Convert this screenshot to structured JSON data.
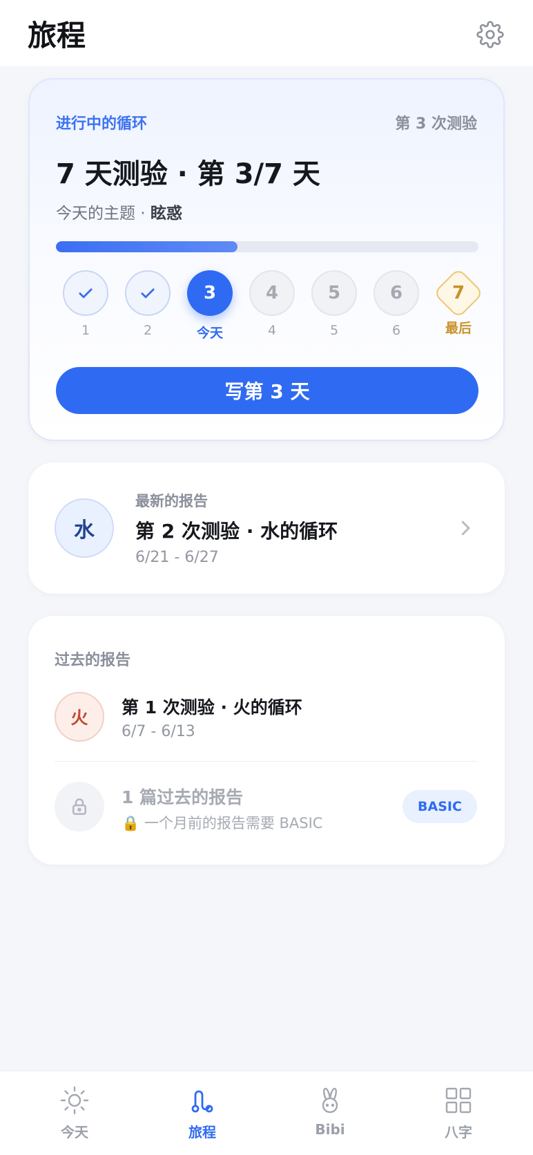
{
  "header": {
    "title": "旅程"
  },
  "cycle": {
    "tag": "进行中的循环",
    "test_count": "第 3 次测验",
    "title": "7 天测验 · 第 3/7 天",
    "theme_prefix": "今天的主题 · ",
    "theme": "眩惑",
    "progress": 0.43,
    "days": [
      {
        "value": "",
        "label": "1",
        "state": "done"
      },
      {
        "value": "",
        "label": "2",
        "state": "done"
      },
      {
        "value": "3",
        "label": "今天",
        "state": "current"
      },
      {
        "value": "4",
        "label": "4",
        "state": "future"
      },
      {
        "value": "5",
        "label": "5",
        "state": "future"
      },
      {
        "value": "6",
        "label": "6",
        "state": "future"
      },
      {
        "value": "7",
        "label": "最后",
        "state": "final"
      }
    ],
    "write_button": "写第 3 天"
  },
  "latest_report": {
    "kicker": "最新的报告",
    "badge": "水",
    "title": "第 2 次测验 · 水的循环",
    "dates": "6/21 - 6/27"
  },
  "past_reports": {
    "heading": "过去的报告",
    "items": [
      {
        "badge": "火",
        "title": "第 1 次测验 · 火的循环",
        "dates": "6/7 - 6/13"
      }
    ],
    "locked": {
      "title": "1 篇过去的报告",
      "note": "🔒 一个月前的报告需要 BASIC",
      "badge": "BASIC"
    }
  },
  "tabs": [
    {
      "label": "今天",
      "icon": "sun-icon",
      "active": false
    },
    {
      "label": "旅程",
      "icon": "journey-icon",
      "active": true
    },
    {
      "label": "Bibi",
      "icon": "rabbit-icon",
      "active": false
    },
    {
      "label": "八字",
      "icon": "grid-icon",
      "active": false
    }
  ],
  "colors": {
    "accent": "#2f6bf2",
    "final_day": "#c8922a",
    "water": "#22448f",
    "fire": "#c24a33"
  }
}
